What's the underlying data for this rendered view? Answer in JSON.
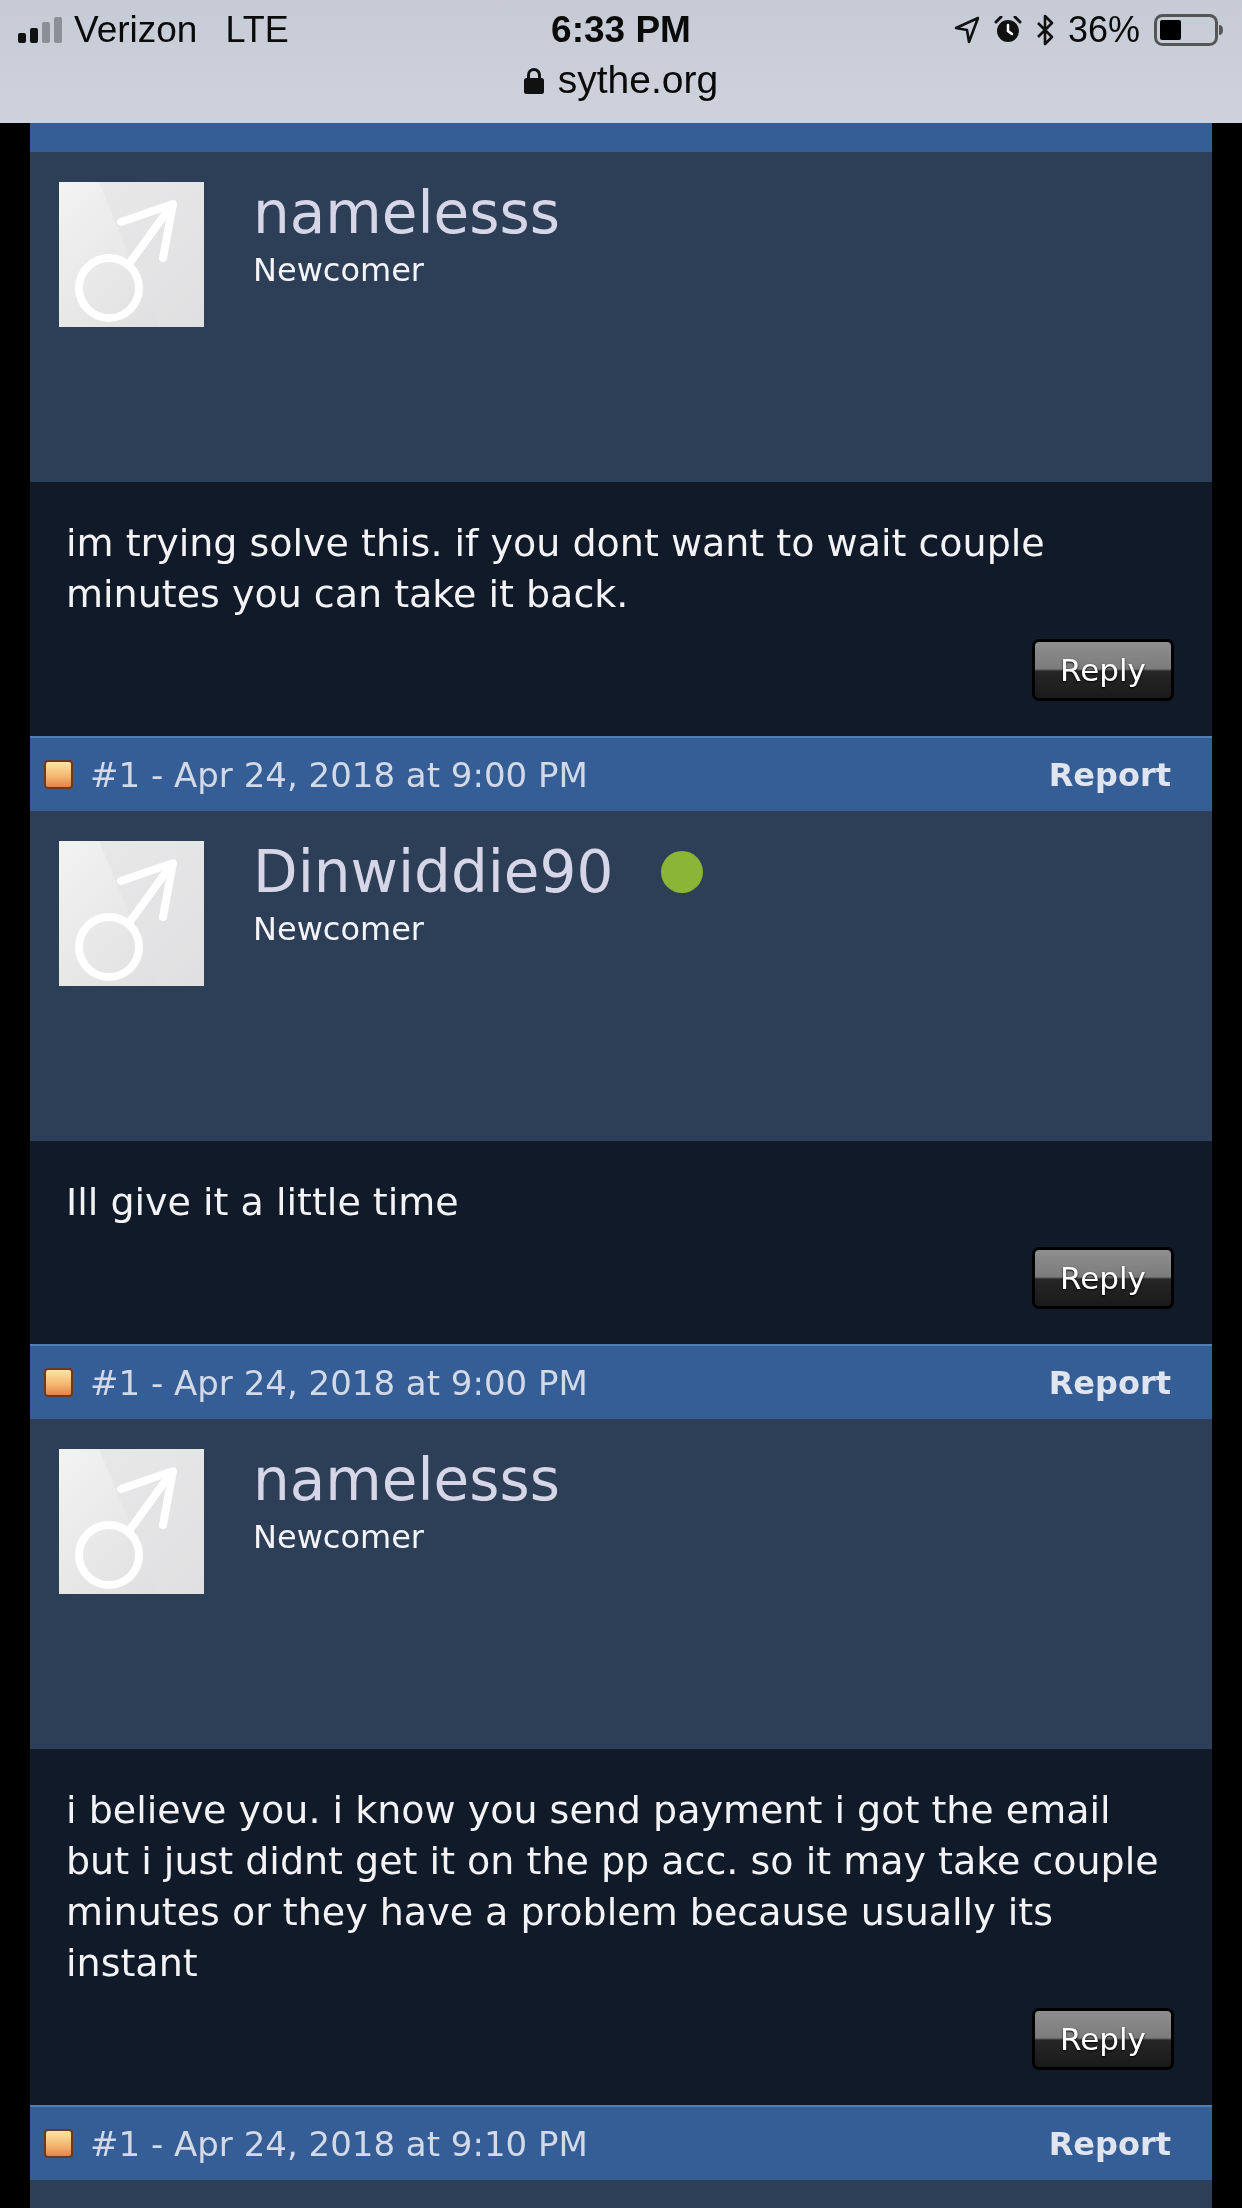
{
  "status_bar": {
    "carrier": "Verizon",
    "network": "LTE",
    "time": "6:33 PM",
    "battery": "36%",
    "url": "sythe.org"
  },
  "posts": [
    {
      "author": {
        "name": "namelesss",
        "rank": "Newcomer",
        "online": false
      },
      "message": "im trying solve this. if you dont want to wait couple minutes you can take it back.",
      "reply": "Reply"
    },
    {
      "header": {
        "title": "#1 - Apr 24, 2018 at 9:00 PM",
        "report": "Report"
      },
      "author": {
        "name": "Dinwiddie90",
        "rank": "Newcomer",
        "online": true
      },
      "message": "Ill give it a little time",
      "reply": "Reply"
    },
    {
      "header": {
        "title": "#1 - Apr 24, 2018 at 9:00 PM",
        "report": "Report"
      },
      "author": {
        "name": "namelesss",
        "rank": "Newcomer",
        "online": false
      },
      "message": "i believe you. i know you send payment i got the email but i just didnt get it on the pp acc. so it may take couple minutes or they have a problem because usually its instant",
      "reply": "Reply"
    },
    {
      "header": {
        "title": "#1 - Apr 24, 2018 at 9:10 PM",
        "report": "Report"
      }
    }
  ]
}
